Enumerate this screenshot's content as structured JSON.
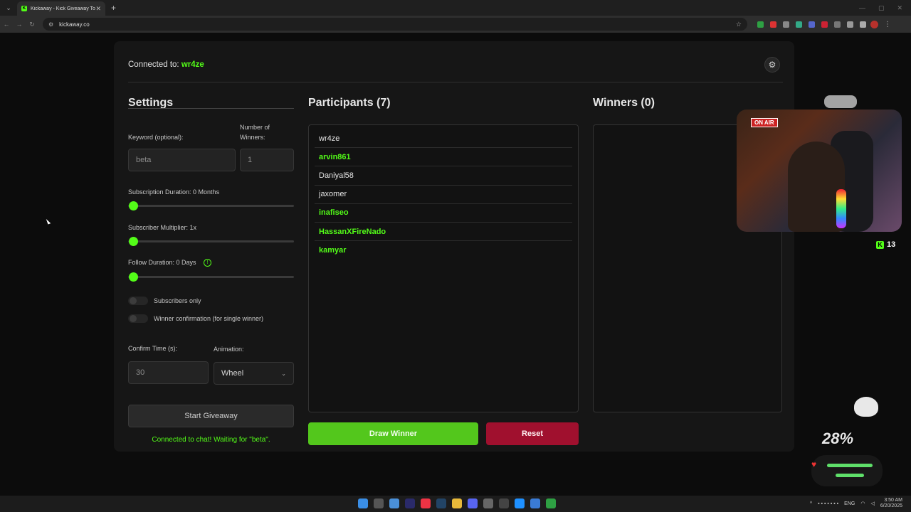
{
  "browser": {
    "tab_title": "Kickaway - Kick Giveaway Tool",
    "tab_favicon": "K",
    "new_tab": "+",
    "tab_close": "✕",
    "url": "kickaway.co"
  },
  "header": {
    "connected_label": "Connected to:",
    "connected_user": "wr4ze"
  },
  "settings": {
    "title": "Settings",
    "keyword_label": "Keyword (optional):",
    "keyword_value": "beta",
    "winners_label_1": "Number of",
    "winners_label_2": "Winners:",
    "winners_value": "1",
    "sub_duration_label": "Subscription Duration: 0 Months",
    "sub_multiplier_label": "Subscriber Multiplier: 1x",
    "follow_duration_label": "Follow Duration:  0  Days",
    "info_glyph": "!",
    "subscribers_only_label": "Subscribers only",
    "winner_confirmation_label": "Winner confirmation (for single winner)",
    "confirm_time_label": "Confirm Time (s):",
    "confirm_time_value": "30",
    "animation_label": "Animation:",
    "animation_value": "Wheel",
    "start_button": "Start Giveaway",
    "status_text": "Connected to chat! Waiting for \"beta\"."
  },
  "participants": {
    "title": "Participants (7)",
    "items": [
      {
        "name": "wr4ze",
        "subscriber": false
      },
      {
        "name": "arvin861",
        "subscriber": true
      },
      {
        "name": "Daniyal58",
        "subscriber": false
      },
      {
        "name": "jaxomer",
        "subscriber": false
      },
      {
        "name": "inafiseo",
        "subscriber": true
      },
      {
        "name": "HassanXFireNado",
        "subscriber": true
      },
      {
        "name": "kamyar",
        "subscriber": true
      }
    ],
    "draw_button": "Draw Winner",
    "reset_button": "Reset"
  },
  "winners": {
    "title": "Winners (0)"
  },
  "overlay": {
    "onair": "ON AIR",
    "viewer_count": "13",
    "kick_glyph": "K",
    "percent": "28%"
  },
  "taskbar": {
    "lang": "ENG",
    "time": "3:50 AM",
    "date": "6/20/2025"
  },
  "colors": {
    "accent": "#53fc18",
    "draw_button": "#53c71c",
    "reset_button": "#a0102e"
  }
}
